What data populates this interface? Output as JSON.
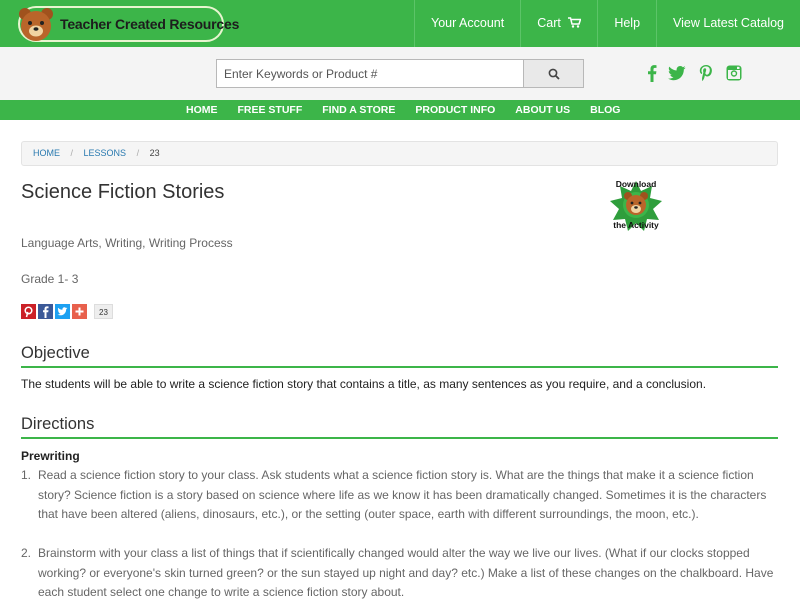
{
  "header": {
    "logo_text": "Teacher Created Resources",
    "links": {
      "account": "Your Account",
      "cart": "Cart",
      "help": "Help",
      "catalog": "View Latest Catalog"
    }
  },
  "search": {
    "placeholder": "Enter Keywords or Product #",
    "value": ""
  },
  "social": [
    "facebook-icon",
    "twitter-icon",
    "pinterest-icon",
    "instagram-icon"
  ],
  "nav": {
    "home": "HOME",
    "free_stuff": "FREE STUFF",
    "find_store": "FIND A STORE",
    "product_info": "PRODUCT INFO",
    "about_us": "ABOUT US",
    "blog": "BLOG"
  },
  "breadcrumb": {
    "home": "HOME",
    "lessons": "LESSONS",
    "current": "23",
    "separator": "/"
  },
  "lesson": {
    "title": "Science Fiction Stories",
    "subjects": "Language Arts, Writing, Writing Process",
    "grade": "Grade 1- 3",
    "share_count": "23",
    "download_top": "Download",
    "download_bottom": "the Activity"
  },
  "objective": {
    "heading": "Objective",
    "text": "The students will be able to write a science fiction story that contains a title, as many sentences as you require, and a conclusion."
  },
  "directions": {
    "heading": "Directions",
    "subheading": "Prewriting",
    "steps": [
      {
        "num": "1.",
        "text": "Read a science fiction story to your class. Ask students what a science fiction story is. What are the things that make it a science fiction story? Science fiction is a story based on science where life as we know it has been dramatically changed. Sometimes it is the characters that have been altered (aliens, dinosaurs, etc.), or the setting (outer space, earth with different surroundings, the moon, etc.)."
      },
      {
        "num": "2.",
        "text": "Brainstorm with your class a list of things that if scientifically changed would alter the way we live our lives. (What if our clocks stopped working? or everyone's skin turned green? or the sun stayed up night and day? etc.) Make a list of these changes on the chalkboard. Have each student select one change to write a science fiction story about."
      }
    ]
  },
  "colors": {
    "brand_green": "#3cb549",
    "link_blue": "#2a7ab0"
  }
}
